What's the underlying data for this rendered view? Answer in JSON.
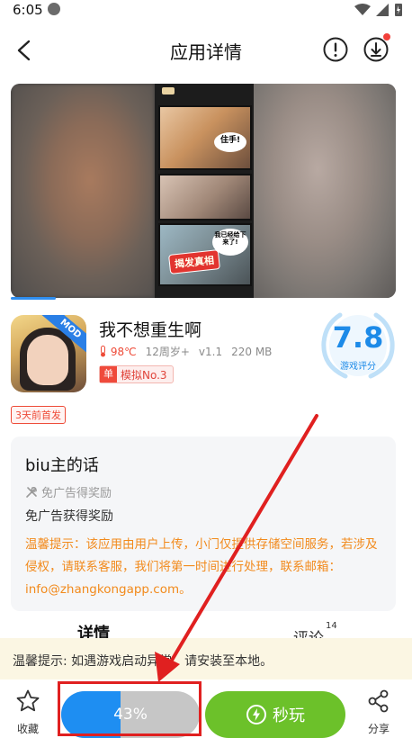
{
  "status_bar": {
    "time": "6:05"
  },
  "header": {
    "title": "应用详情"
  },
  "gallery": {
    "speech_1": "住手!",
    "speech_2": "我已经给下来了!",
    "banner": "揭发真相"
  },
  "app": {
    "name": "我不想重生啊",
    "badge": "MOD",
    "temperature": "98℃",
    "age": "12周岁+",
    "version": "v1.1",
    "size": "220 MB",
    "rank_badge": "单",
    "rank_text": "模拟No.3",
    "score": "7.8",
    "score_label": "游戏评分",
    "first_tag": "3天前首发"
  },
  "uploader_card": {
    "title": "biu主的话",
    "feature": "免广告得奖励",
    "description": "免广告获得奖励",
    "notice": "温馨提示：该应用由用户上传，小门仅提供存储空间服务，若涉及侵权，请联系客服，我们将第一时间进行处理，联系邮箱：info@zhangkongapp.com。"
  },
  "tabs": {
    "details": "详情",
    "comments": "评论",
    "comments_count": "14"
  },
  "tip_bar": {
    "text": "温馨提示: 如遇游戏启动异常，请安装至本地。"
  },
  "bottom_bar": {
    "favorite_label": "收藏",
    "progress_text": "43%",
    "progress": 0.43,
    "play_label": "秒玩",
    "share_label": "分享"
  },
  "colors": {
    "accent_blue": "#1e8ef2",
    "play_green": "#6cc12a",
    "notice_orange": "#f28a1c",
    "annotation_red": "#e02020"
  }
}
